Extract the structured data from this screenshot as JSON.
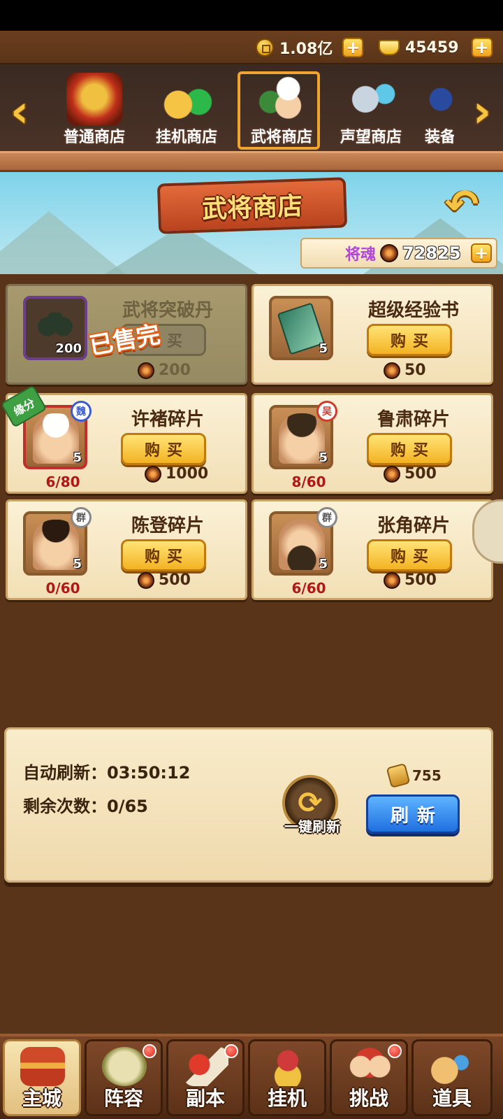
{
  "currency": {
    "coins": "1.08亿",
    "ingots": "45459",
    "plus_label": "+"
  },
  "tabs": [
    {
      "label": "普通商店",
      "selected": false
    },
    {
      "label": "挂机商店",
      "selected": false
    },
    {
      "label": "武将商店",
      "selected": true
    },
    {
      "label": "声望商店",
      "selected": false
    },
    {
      "label": "装备",
      "selected": false
    }
  ],
  "arrows": {
    "left": "‹",
    "right": "›",
    "back": "↶"
  },
  "banner": {
    "title": "武将商店",
    "soul_label": "将魂",
    "soul_value": "72825"
  },
  "items": [
    {
      "name": "武将突破丹",
      "qty": "200",
      "buy_label": "购买",
      "price": "200",
      "sold": true,
      "sold_label": "已售完",
      "progress": ""
    },
    {
      "name": "超级经验书",
      "qty": "5",
      "buy_label": "购买",
      "price": "50",
      "sold": false,
      "progress": ""
    },
    {
      "name": "许褚碎片",
      "qty": "5",
      "buy_label": "购买",
      "price": "1000",
      "sold": false,
      "progress": "6/80",
      "kingdom": "魏",
      "tag": "缘分"
    },
    {
      "name": "鲁肃碎片",
      "qty": "5",
      "buy_label": "购买",
      "price": "500",
      "sold": false,
      "progress": "8/60",
      "kingdom": "吴"
    },
    {
      "name": "陈登碎片",
      "qty": "5",
      "buy_label": "购买",
      "price": "500",
      "sold": false,
      "progress": "0/60",
      "kingdom": "群"
    },
    {
      "name": "张角碎片",
      "qty": "5",
      "buy_label": "购买",
      "price": "500",
      "sold": false,
      "progress": "6/60",
      "kingdom": "群"
    }
  ],
  "refresh": {
    "auto_label": "自动刷新：",
    "auto_time": "03:50:12",
    "remaining_label": "剩余次数：",
    "remaining_value": "0/65",
    "one_key_label": "一键刷新",
    "cost": "755",
    "button_label": "刷新"
  },
  "nav": [
    {
      "label": "主城",
      "active": true,
      "dot": false
    },
    {
      "label": "阵容",
      "active": false,
      "dot": true
    },
    {
      "label": "副本",
      "active": false,
      "dot": true
    },
    {
      "label": "挂机",
      "active": false,
      "dot": false
    },
    {
      "label": "挑战",
      "active": false,
      "dot": true
    },
    {
      "label": "道具",
      "active": false,
      "dot": false
    }
  ],
  "colors": {
    "accent_gold": "#f6c445",
    "panel_brown": "#5a3418",
    "price_red": "#b01818",
    "refresh_blue": "#1f6fe0"
  }
}
